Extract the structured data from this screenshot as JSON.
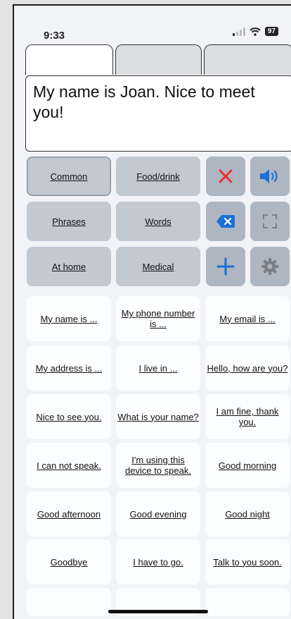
{
  "status": {
    "time": "9:33",
    "battery": "97"
  },
  "tabs": [
    "",
    "",
    ""
  ],
  "text_display": "My name is Joan. Nice to meet you!",
  "categories": [
    {
      "label": "Common",
      "selected": true
    },
    {
      "label": "Food/drink",
      "selected": false
    },
    {
      "label": "Phrases",
      "selected": false
    },
    {
      "label": "Words",
      "selected": false
    },
    {
      "label": "At home",
      "selected": false
    },
    {
      "label": "Medical",
      "selected": false
    }
  ],
  "icons": {
    "clear": "close-icon",
    "speak": "speaker-icon",
    "backspace": "backspace-icon",
    "fullscreen": "fullscreen-icon",
    "add": "plus-icon",
    "settings": "gear-icon"
  },
  "colors": {
    "accent_blue": "#1c6fd6",
    "clear_red": "#e83030",
    "icon_gray": "#7a7f86"
  },
  "phrases": [
    "My name is ...",
    "My phone number is ...",
    "My email is ...",
    "My address is ...",
    "I live in ...",
    "Hello, how are you?",
    "Nice to see you.",
    "What is your name?",
    "I am fine, thank you.",
    "I can not speak.",
    "I'm using this device to speak.",
    "Good morning",
    "Good afternoon",
    "Good evening",
    "Good night",
    "Goodbye",
    "I have to go.",
    "Talk to you soon."
  ]
}
